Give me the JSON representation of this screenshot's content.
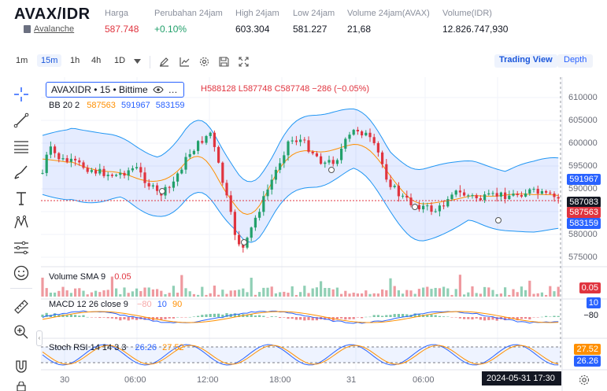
{
  "header": {
    "pair": "AVAX/IDR",
    "subtitle": "Avalanche",
    "stats": [
      {
        "label": "Harga",
        "value": "587.748",
        "color": "red"
      },
      {
        "label": "Perubahan 24jam",
        "value": "+0.10%",
        "color": "green"
      },
      {
        "label": "High 24jam",
        "value": "603.304",
        "color": ""
      },
      {
        "label": "Low 24jam",
        "value": "581.227",
        "color": ""
      },
      {
        "label": "Volume 24jam(AVAX)",
        "value": "21,68",
        "color": ""
      },
      {
        "label": "Volume(IDR)",
        "value": "12.826.747,930",
        "color": ""
      }
    ]
  },
  "toolbar": {
    "intervals": [
      "1m",
      "15m",
      "1h",
      "4h",
      "1D"
    ],
    "active_interval": "15m",
    "trading_view": "Trading View",
    "depth": "Depth"
  },
  "chart": {
    "symbol": "AVAXIDR • 15 • Bittime",
    "ohlc": "H588128  L587748  C587748  −286 (−0.05%)",
    "bb_label": "BB 20 2",
    "bb_mid": "587563",
    "bb_upper": "591967",
    "bb_lower": "583159",
    "vol_label": "Volume SMA 9",
    "vol_val": "0.05",
    "macd_label": "MACD 12 26 close 9",
    "macd_vals": [
      "−80",
      "10",
      "90"
    ],
    "rsi_label": "Stoch RSI 14 14 3 3",
    "rsi_vals": [
      "26.26",
      "27.52"
    ],
    "price_axis": [
      "610000",
      "605000",
      "600000",
      "595000",
      "590000",
      "585000",
      "580000",
      "575000"
    ],
    "price_tags": {
      "upper": "591967",
      "last": "587083",
      "mid": "587563",
      "lower": "583159",
      "volume": "0.05",
      "macd_a": "10",
      "macd_b": "−80",
      "rsi_a": "27.52",
      "rsi_b": "26.26"
    },
    "time_axis": [
      "30",
      "06:00",
      "12:00",
      "18:00",
      "31",
      "06:00"
    ],
    "crosshair_time": "2024-05-31   17:30"
  }
}
